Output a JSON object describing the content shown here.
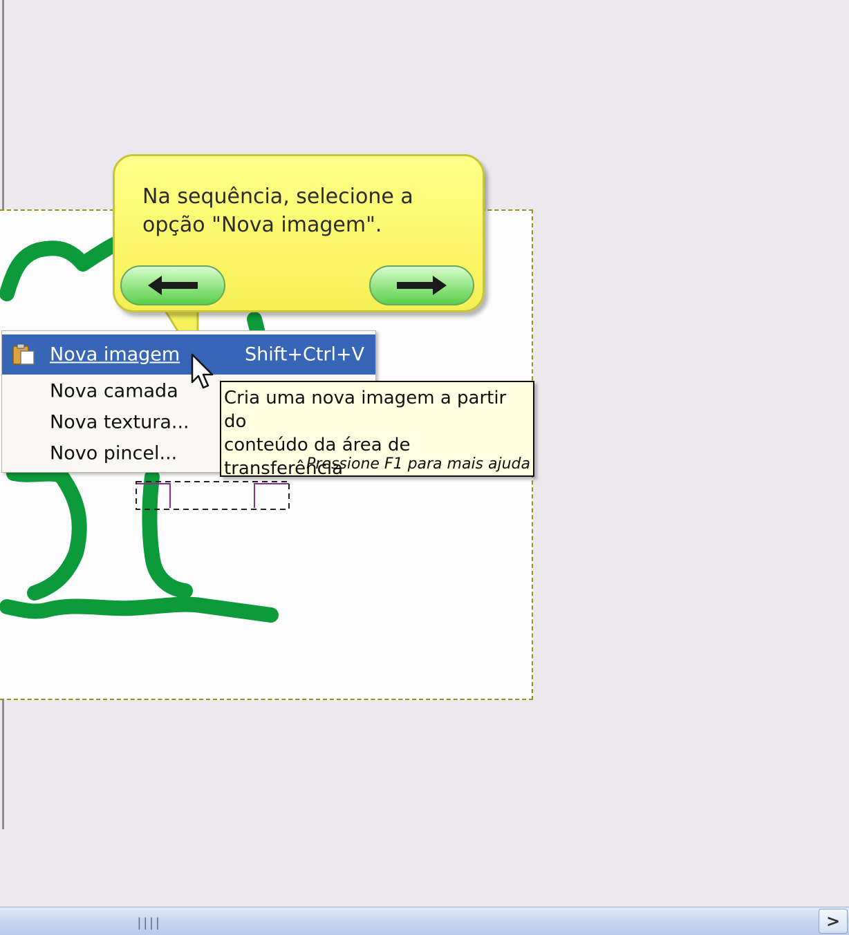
{
  "tutorial": {
    "instruction": "Na sequência, selecione a\nopção \"Nova imagem\".",
    "back_icon": "arrow-left-icon",
    "next_icon": "arrow-right-icon"
  },
  "menu": {
    "items": [
      {
        "label": "Nova imagem",
        "shortcut": "Shift+Ctrl+V",
        "icon": "paste-icon",
        "active": true
      },
      {
        "label": "Nova camada",
        "shortcut": ""
      },
      {
        "label": "Nova textura...",
        "shortcut": ""
      },
      {
        "label": "Novo pincel...",
        "shortcut": ""
      }
    ]
  },
  "tooltip": {
    "description": "Cria uma nova imagem a partir do\nconteúdo da área de transferência",
    "help": "Pressione F1 para mais ajuda"
  },
  "colors": {
    "callout": "#fbf668",
    "menu_highlight": "#3766b6",
    "stroke": "#0d9a3a",
    "tooltip_bg": "#ffffe1"
  }
}
